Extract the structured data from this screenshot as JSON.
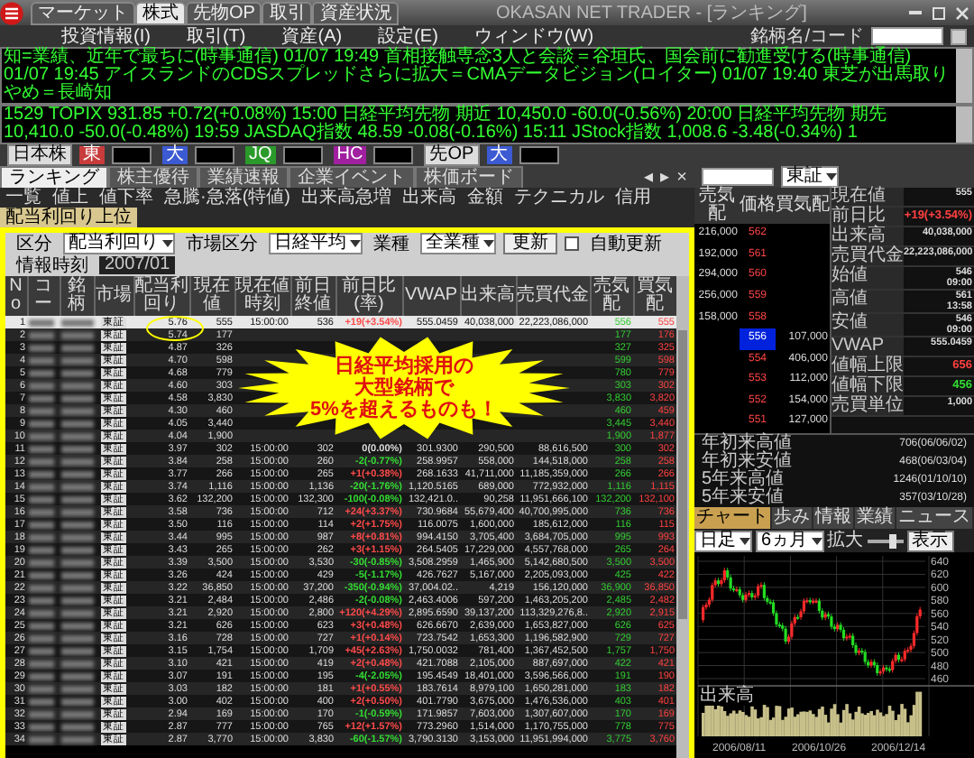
{
  "window": {
    "title": "OKASAN NET TRADER - [ランキング]",
    "app_tabs": [
      {
        "label": "マーケット",
        "selected": false
      },
      {
        "label": "株式",
        "selected": true
      },
      {
        "label": "先物OP",
        "selected": false
      },
      {
        "label": "取引",
        "selected": false
      },
      {
        "label": "資産状況",
        "selected": false
      }
    ]
  },
  "menu": [
    "投資情報(I)",
    "取引(T)",
    "資産(A)",
    "設定(E)",
    "ウィンドウ(W)"
  ],
  "symbol_search": {
    "label": "銘柄名/コード"
  },
  "tickers": [
    "知=業績、近年で最ちに(時事通信) 01/07 19:49 首相接触専念3人と会談＝谷垣氏、国会前に勧進受ける(時事通信) 01/07 19:45 アイスランドのCDSスプレッドさらに拡大＝CMAデータビジョン(ロイター) 01/07 19:40 東芝が出馬取りやめ＝長崎知",
    "1529   TOPIX 931.85 +0.72(+0.08%) 15:00   日経平均先物 期近 10,450.0 -60.0(-0.56%) 20:00   日経平均先物 期先 10,410.0 -50.0(-0.48%) 19:59   JASDAQ指数 48.59 -0.08(-0.16%) 15:11   JStock指数 1,008.6 -3.48(-0.34%) 1"
  ],
  "index_bar": [
    {
      "kind": "label",
      "label": "日本株"
    },
    {
      "kind": "quote",
      "label": "東",
      "color": "#c83c3c"
    },
    {
      "kind": "quote",
      "label": "大",
      "color": "#3c5ad2"
    },
    {
      "kind": "quote",
      "label": "JQ",
      "color": "#2a9a2a"
    },
    {
      "kind": "quote",
      "label": "HC",
      "color": "#a020a0"
    },
    {
      "kind": "label",
      "label": "先OP"
    },
    {
      "kind": "quote",
      "label": "大",
      "color": "#3c5ad2"
    }
  ],
  "function_tabs": [
    {
      "label": "ランキング",
      "selected": true
    },
    {
      "label": "株主優待",
      "selected": false
    },
    {
      "label": "業績速報",
      "selected": false
    },
    {
      "label": "企業イベント",
      "selected": false
    },
    {
      "label": "株価ボード",
      "selected": false
    }
  ],
  "tab_nav": [
    "◂",
    "▸",
    "×"
  ],
  "ranking_tabs": [
    {
      "label": "一覧",
      "selected": false
    },
    {
      "label": "値上",
      "selected": false
    },
    {
      "label": "値下率",
      "selected": false
    },
    {
      "label": "急騰·急落(特値)",
      "selected": false
    },
    {
      "label": "出来高急増",
      "selected": false
    },
    {
      "label": "出来高",
      "selected": false
    },
    {
      "label": "金額",
      "selected": false
    },
    {
      "label": "テクニカル",
      "selected": false
    },
    {
      "label": "信用",
      "selected": false
    },
    {
      "label": "配当利回り上位",
      "selected": true
    }
  ],
  "filter": {
    "type_label": "区分",
    "type_value": "配当利回り",
    "market_label": "市場区分",
    "market_value": "日経平均",
    "sector_label": "業種",
    "sector_value": "全業種",
    "update_button": "更新",
    "auto_update": {
      "label": "自動更新",
      "checked": false
    },
    "time_label": "情報時刻",
    "time_value": "2007/01"
  },
  "table": {
    "columns": [
      "No",
      "コー",
      "銘柄",
      "市場",
      "配当利回り",
      "現在値",
      "現在値時刻",
      "前日終値",
      "前日比(率)",
      "VWAP",
      "出来高",
      "売買代金",
      "売気配",
      "買気配"
    ],
    "rows": [
      {
        "selected": true,
        "color": "#ff4a4a",
        "cells": [
          "1",
          null,
          null,
          "東証",
          "5.76",
          "555",
          "15:00:00",
          "536",
          "+19(+3.54%)",
          "555.0459",
          "40,038,000",
          "22,223,086,000",
          "556",
          "555"
        ]
      },
      {
        "selected": false,
        "cells": [
          "2",
          null,
          null,
          "東証",
          "5.74",
          "177",
          null,
          null,
          null,
          null,
          null,
          null,
          "177",
          "176"
        ]
      },
      {
        "selected": false,
        "cells": [
          "3",
          null,
          null,
          "東証",
          "4.87",
          "326",
          null,
          null,
          null,
          null,
          null,
          null,
          "327",
          "325"
        ]
      },
      {
        "selected": false,
        "cells": [
          "4",
          null,
          null,
          "東証",
          "4.70",
          "598",
          null,
          null,
          null,
          null,
          null,
          null,
          "599",
          "598"
        ]
      },
      {
        "selected": false,
        "cells": [
          "5",
          null,
          null,
          "東証",
          "4.68",
          "779",
          null,
          null,
          null,
          null,
          null,
          null,
          "780",
          "779"
        ]
      },
      {
        "selected": false,
        "cells": [
          "6",
          null,
          null,
          "東証",
          "4.60",
          "303",
          null,
          null,
          null,
          null,
          null,
          null,
          "303",
          "302"
        ]
      },
      {
        "selected": false,
        "cells": [
          "7",
          null,
          null,
          "東証",
          "4.58",
          "3,830",
          null,
          null,
          null,
          null,
          null,
          null,
          "3,830",
          "3,820"
        ]
      },
      {
        "selected": false,
        "cells": [
          "8",
          null,
          null,
          "東証",
          "4.30",
          "460",
          null,
          null,
          null,
          null,
          null,
          null,
          "460",
          "459"
        ]
      },
      {
        "selected": false,
        "cells": [
          "9",
          null,
          null,
          "東証",
          "4.05",
          "3,440",
          null,
          null,
          null,
          null,
          null,
          null,
          "3,445",
          "3,440"
        ]
      },
      {
        "selected": false,
        "cells": [
          "10",
          null,
          null,
          "東証",
          "4.04",
          "1,900",
          null,
          null,
          null,
          null,
          null,
          null,
          "1,900",
          "1,877"
        ]
      },
      {
        "selected": false,
        "color": "#dddddd",
        "cells": [
          "11",
          null,
          null,
          "東証",
          "3.97",
          "302",
          "15:00:00",
          "302",
          "0(0.00%)",
          "301.9300",
          "290,500",
          "88,616,500",
          "300",
          "302"
        ]
      },
      {
        "selected": false,
        "color": "#33dd33",
        "cells": [
          "12",
          null,
          null,
          "東証",
          "3.84",
          "258",
          "15:00:00",
          "260",
          "-2(-0.77%)",
          "258.9957",
          "558,000",
          "144,518,000",
          "258",
          "258"
        ]
      },
      {
        "selected": false,
        "color": "#ff4a4a",
        "cells": [
          "13",
          null,
          null,
          "東証",
          "3.77",
          "266",
          "15:00:00",
          "265",
          "+1(+0.38%)",
          "268.1633",
          "41,711,000",
          "11,185,359,000",
          "266",
          "266"
        ]
      },
      {
        "selected": false,
        "color": "#33dd33",
        "cells": [
          "14",
          null,
          null,
          "東証",
          "3.74",
          "1,116",
          "15:00:00",
          "1,136",
          "-20(-1.76%)",
          "1,120.5165",
          "689,000",
          "772,932,000",
          "1,116",
          "1,115"
        ]
      },
      {
        "selected": false,
        "color": "#33dd33",
        "cells": [
          "15",
          null,
          null,
          "東証",
          "3.62",
          "132,200",
          "15:00:00",
          "132,300",
          "-100(-0.08%)",
          "132,421.0..",
          "90,258",
          "11,951,666,100",
          "132,200",
          "132,100"
        ]
      },
      {
        "selected": false,
        "color": "#ff4a4a",
        "cells": [
          "16",
          null,
          null,
          "東証",
          "3.58",
          "736",
          "15:00:00",
          "712",
          "+24(+3.37%)",
          "730.9684",
          "55,679,400",
          "40,700,995,000",
          "736",
          "736"
        ]
      },
      {
        "selected": false,
        "color": "#ff4a4a",
        "cells": [
          "17",
          null,
          null,
          "東証",
          "3.50",
          "116",
          "15:00:00",
          "114",
          "+2(+1.75%)",
          "116.0075",
          "1,600,000",
          "185,612,000",
          "116",
          "115"
        ]
      },
      {
        "selected": false,
        "color": "#ff4a4a",
        "cells": [
          "18",
          null,
          null,
          "東証",
          "3.44",
          "995",
          "15:00:00",
          "987",
          "+8(+0.81%)",
          "994.4150",
          "3,705,400",
          "3,684,705,000",
          "995",
          "993"
        ]
      },
      {
        "selected": false,
        "color": "#ff4a4a",
        "cells": [
          "19",
          null,
          null,
          "東証",
          "3.43",
          "265",
          "15:00:00",
          "262",
          "+3(+1.15%)",
          "264.5405",
          "17,229,000",
          "4,557,768,000",
          "265",
          "264"
        ]
      },
      {
        "selected": false,
        "color": "#33dd33",
        "cells": [
          "20",
          null,
          null,
          "東証",
          "3.39",
          "3,500",
          "15:00:00",
          "3,530",
          "-30(-0.85%)",
          "3,508.2959",
          "1,465,900",
          "5,142,680,500",
          "3,500",
          "3,500"
        ]
      },
      {
        "selected": false,
        "color": "#33dd33",
        "cells": [
          "21",
          null,
          null,
          "東証",
          "3.26",
          "424",
          "15:00:00",
          "429",
          "-5(-1.17%)",
          "426.7627",
          "5,167,000",
          "2,205,093,000",
          "425",
          "422"
        ]
      },
      {
        "selected": false,
        "color": "#33dd33",
        "cells": [
          "22",
          null,
          null,
          "東証",
          "3.22",
          "36,850",
          "15:00:00",
          "37,200",
          "-350(-0.94%)",
          "37,004.02..",
          "4,219",
          "156,120,000",
          "36,900",
          "36,850"
        ]
      },
      {
        "selected": false,
        "color": "#33dd33",
        "cells": [
          "23",
          null,
          null,
          "東証",
          "3.21",
          "2,484",
          "15:00:00",
          "2,486",
          "-2(-0.08%)",
          "2,463.4006",
          "597,200",
          "1,463,205,200",
          "2,485",
          "2,482"
        ]
      },
      {
        "selected": false,
        "color": "#ff4a4a",
        "cells": [
          "24",
          null,
          null,
          "東証",
          "3.21",
          "2,920",
          "15:00:00",
          "2,800",
          "+120(+4.29%)",
          "2,895.6590",
          "39,137,200",
          "113,329,276,8..",
          "2,920",
          "2,915"
        ]
      },
      {
        "selected": false,
        "color": "#ff4a4a",
        "cells": [
          "25",
          null,
          null,
          "東証",
          "3.21",
          "626",
          "15:00:00",
          "623",
          "+3(+0.48%)",
          "626.6670",
          "2,639,000",
          "1,653,827,000",
          "626",
          "625"
        ]
      },
      {
        "selected": false,
        "color": "#ff4a4a",
        "cells": [
          "26",
          null,
          null,
          "東証",
          "3.16",
          "728",
          "15:00:00",
          "727",
          "+1(+0.14%)",
          "723.7542",
          "1,653,300",
          "1,196,582,900",
          "729",
          "727"
        ]
      },
      {
        "selected": false,
        "color": "#ff4a4a",
        "cells": [
          "27",
          null,
          null,
          "東証",
          "3.15",
          "1,754",
          "15:00:00",
          "1,709",
          "+45(+2.63%)",
          "1,750.0032",
          "781,400",
          "1,367,452,500",
          "1,757",
          "1,750"
        ]
      },
      {
        "selected": false,
        "color": "#ff4a4a",
        "cells": [
          "28",
          null,
          null,
          "東証",
          "3.10",
          "421",
          "15:00:00",
          "419",
          "+2(+0.48%)",
          "421.7088",
          "2,105,000",
          "887,697,000",
          "422",
          "421"
        ]
      },
      {
        "selected": false,
        "color": "#33dd33",
        "cells": [
          "29",
          null,
          null,
          "東証",
          "3.07",
          "191",
          "15:00:00",
          "195",
          "-4(-2.05%)",
          "195.4549",
          "18,401,000",
          "3,596,566,000",
          "191",
          "190"
        ]
      },
      {
        "selected": false,
        "color": "#ff4a4a",
        "cells": [
          "30",
          null,
          null,
          "東証",
          "3.03",
          "182",
          "15:00:00",
          "181",
          "+1(+0.55%)",
          "183.7614",
          "8,979,100",
          "1,650,281,000",
          "183",
          "182"
        ]
      },
      {
        "selected": false,
        "color": "#ff4a4a",
        "cells": [
          "31",
          null,
          null,
          "東証",
          "3.00",
          "402",
          "15:00:00",
          "400",
          "+2(+0.50%)",
          "401.7790",
          "3,675,000",
          "1,476,536,000",
          "403",
          "401"
        ]
      },
      {
        "selected": false,
        "color": "#33dd33",
        "cells": [
          "32",
          null,
          null,
          "東証",
          "2.94",
          "169",
          "15:00:00",
          "170",
          "-1(-0.59%)",
          "171.9857",
          "7,603,000",
          "1,307,607,000",
          "170",
          "169"
        ]
      },
      {
        "selected": false,
        "color": "#ff4a4a",
        "cells": [
          "33",
          null,
          null,
          "東証",
          "2.87",
          "777",
          "15:00:00",
          "765",
          "+12(+1.57%)",
          "773.2960",
          "1,514,000",
          "1,170,755,000",
          "778",
          "775"
        ]
      },
      {
        "selected": false,
        "color": "#33dd33",
        "cells": [
          "34",
          null,
          null,
          "東証",
          "2.87",
          "3,770",
          "15:00:00",
          "3,830",
          "-60(-1.57%)",
          "3,790.3130",
          "3,153,000",
          "11,951,994,000",
          "3,775",
          "3,760"
        ]
      }
    ]
  },
  "callout": {
    "lines": [
      "日経平均採用の",
      "大型銘柄で",
      "5%を超えるものも！"
    ]
  },
  "quote_panel": {
    "market": "東証",
    "board": {
      "columns": [
        "売気配",
        "価格",
        "買気配"
      ],
      "rows": [
        {
          "sell": "216,000",
          "price": "562",
          "selected": false
        },
        {
          "sell": "192,000",
          "price": "561",
          "selected": false
        },
        {
          "sell": "294,000",
          "price": "560",
          "selected": false
        },
        {
          "sell": "256,000",
          "price": "559",
          "selected": false
        },
        {
          "sell": "158,000",
          "price": "558",
          "selected": false
        },
        {
          "price": "556",
          "buy": "107,000",
          "selected": true
        },
        {
          "price": "554",
          "buy": "406,000",
          "selected": false
        },
        {
          "price": "553",
          "buy": "112,000",
          "selected": false
        },
        {
          "price": "552",
          "buy": "154,000",
          "selected": false
        },
        {
          "price": "551",
          "buy": "127,000",
          "selected": false
        }
      ]
    },
    "info": [
      {
        "label": "現在値",
        "values": [
          "555"
        ]
      },
      {
        "label": "前日比",
        "values": [
          "+19(+3.54%)"
        ],
        "color": "#ff4040"
      },
      {
        "label": "出来高",
        "values": [
          "40,038,000"
        ]
      },
      {
        "label": "売買代金",
        "values": [
          "22,223,086,000"
        ]
      },
      {
        "label": "始値",
        "values": [
          "546",
          "09:00"
        ]
      },
      {
        "label": "高値",
        "values": [
          "561",
          "13:58"
        ]
      },
      {
        "label": "安値",
        "values": [
          "546",
          "09:00"
        ]
      },
      {
        "label": "VWAP",
        "values": [
          "555.0459"
        ]
      },
      {
        "label": "値幅上限",
        "values": [
          "656"
        ],
        "color": "#ff4040"
      },
      {
        "label": "値幅下限",
        "values": [
          "456"
        ],
        "color": "#33dd33"
      },
      {
        "label": "売買単位",
        "values": [
          "1,000"
        ]
      }
    ],
    "ranges": [
      {
        "label": "年初来高値",
        "value": "706(06/06/02)"
      },
      {
        "label": "年初来安値",
        "value": "468(06/03/04)"
      },
      {
        "label": "5年来高値",
        "value": "1246(01/10/10)"
      },
      {
        "label": "5年来安値",
        "value": "357(03/10/28)"
      }
    ]
  },
  "chart_panel": {
    "tabs": [
      {
        "label": "チャート",
        "selected": true
      },
      {
        "label": "歩み",
        "selected": false
      },
      {
        "label": "情報",
        "selected": false
      },
      {
        "label": "業績",
        "selected": false
      },
      {
        "label": "ニュース",
        "selected": false
      }
    ],
    "period": "日足",
    "span": "6ヵ月",
    "zoom_label": "拡大",
    "zoom": {
      "level": 0.7
    },
    "button": "表示",
    "price_ticks": [
      "640",
      "620",
      "600",
      "580",
      "560",
      "540",
      "520",
      "500",
      "480",
      "460"
    ],
    "volume_label": "出来高",
    "dates": [
      "2006/08/11",
      "2006/10/26",
      "2006/12/14"
    ]
  }
}
